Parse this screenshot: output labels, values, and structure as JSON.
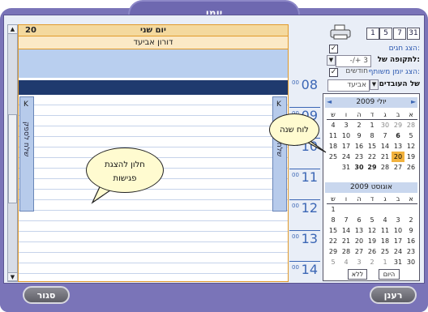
{
  "window": {
    "title": "יומן"
  },
  "toolbar": {
    "view_buttons": [
      "31",
      "7",
      "5",
      "1"
    ]
  },
  "options": {
    "show_holidays_label": "הצג חגים:",
    "period_label": "לתקופה של:",
    "period_value": "-/+ 3 חודשים",
    "show_shared_label": "הצג יומן משותף:",
    "staff_label": "של העובדים",
    "staff_value": "אביעד"
  },
  "day_view": {
    "day_number": "20",
    "day_name": "יום שני",
    "owner": "דורון אביעד",
    "side_tab_label": "שלח לספק",
    "hours": [
      "08",
      "09",
      "10",
      "11",
      "12",
      "13",
      "14"
    ],
    "minutes_label": "00"
  },
  "calendar": {
    "july": {
      "title": "יולי 2009",
      "weekdays": [
        "א",
        "ב",
        "ג",
        "ד",
        "ה",
        "ו",
        "ש"
      ],
      "weeks": [
        [
          "28",
          "29",
          "30",
          "1",
          "2",
          "3",
          "4"
        ],
        [
          "5",
          "6",
          "7",
          "8",
          "9",
          "10",
          "11"
        ],
        [
          "12",
          "13",
          "14",
          "15",
          "16",
          "17",
          "18"
        ],
        [
          "19",
          "20",
          "21",
          "22",
          "23",
          "24",
          "25"
        ],
        [
          "26",
          "27",
          "28",
          "29",
          "30",
          "31",
          ""
        ]
      ]
    },
    "august": {
      "title": "אוגוסט 2009",
      "weekdays": [
        "א",
        "ב",
        "ג",
        "ד",
        "ה",
        "ו",
        "ש"
      ],
      "weeks": [
        [
          "",
          "",
          "",
          "",
          "",
          "",
          "1"
        ],
        [
          "2",
          "3",
          "4",
          "5",
          "6",
          "7",
          "8"
        ],
        [
          "9",
          "10",
          "11",
          "12",
          "13",
          "14",
          "15"
        ],
        [
          "16",
          "17",
          "18",
          "19",
          "20",
          "21",
          "22"
        ],
        [
          "23",
          "24",
          "25",
          "26",
          "27",
          "28",
          "29"
        ],
        [
          "30",
          "31",
          "1",
          "2",
          "3",
          "4",
          "5"
        ]
      ]
    },
    "today_button": "היום",
    "none_button": "ללא"
  },
  "callouts": {
    "calendar_bubble": "לוח שנה",
    "meetings_bubble": "חלון להצגת פגישות"
  },
  "footer": {
    "refresh_button": "רענן",
    "close_button": "סגור"
  }
}
